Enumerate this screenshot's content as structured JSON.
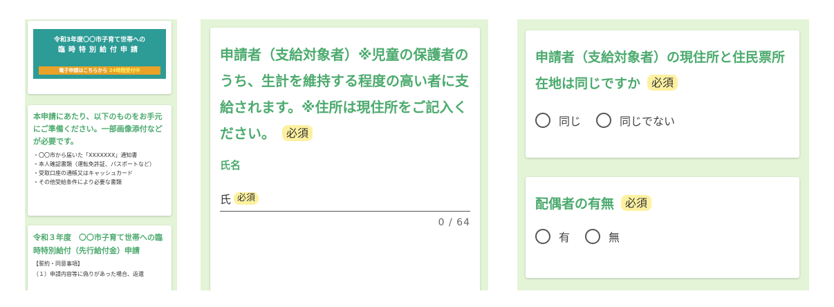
{
  "left_panel": {
    "banner": {
      "line1": "令和3年度〇〇市子育て世帯への",
      "line2": "臨時特別給付申請",
      "strip_text": "電子申請はこちらから",
      "strip_highlight": "24時間受付中"
    },
    "prep": {
      "heading": "本申請にあたり、以下のものをお手元にご準備ください。一部画像添付などが必要です。",
      "items": [
        "・〇〇市から届いた「XXXXXXX」通知書",
        "・本人確認書類（運転免許証、パスポートなど）",
        "・受取口座の通帳又はキャッシュカード",
        "・その他受給条件により必要な書類"
      ]
    },
    "form": {
      "heading": "令和３年度　〇〇市子育て世帯への臨時特別給付（先行給付金）申請",
      "sub": "【誓約・同意事項】",
      "sub2": "（１）申請内容等に偽りがあった場合、返還"
    }
  },
  "applicant": {
    "question": "申請者（支給対象者）※児童の保護者のうち、生計を維持する程度の高い者に支給されます。※住所は現住所をご記入ください。",
    "required": "必須",
    "name_label": "氏名",
    "name_field_prefix": "氏",
    "name_field_required": "必須",
    "counter": "0 / 64"
  },
  "address": {
    "question": "申請者（支給対象者）の現住所と住民票所在地は同じですか",
    "required": "必須",
    "options": [
      "同じ",
      "同じでない"
    ]
  },
  "spouse": {
    "question": "配偶者の有無",
    "required": "必須",
    "options": [
      "有",
      "無"
    ]
  },
  "colors": {
    "accent": "#4caa6e",
    "panel_bg": "#e3f4d7",
    "banner": "#2d9b96",
    "required_badge": "#fdf1a0"
  }
}
